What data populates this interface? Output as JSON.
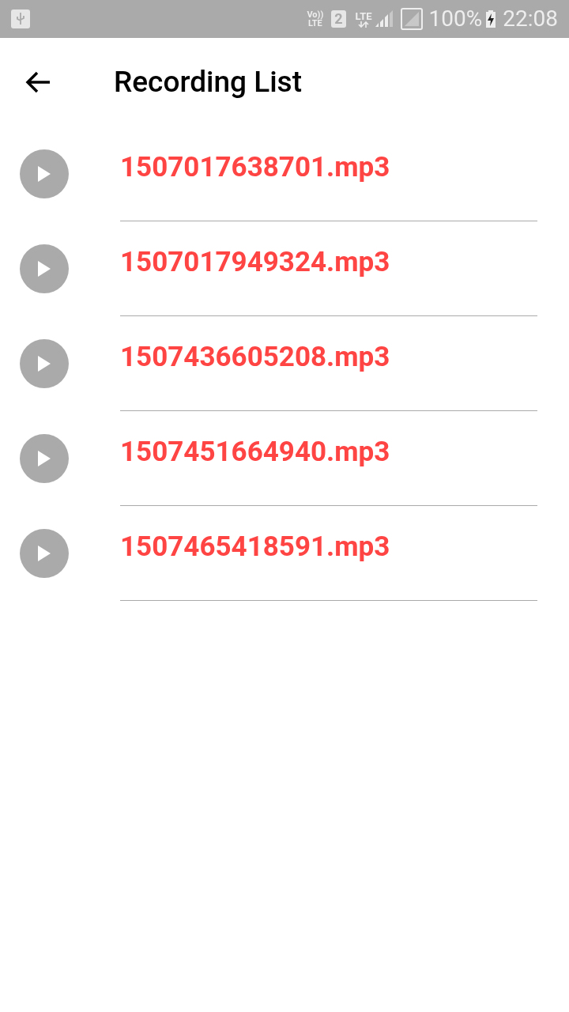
{
  "status_bar": {
    "volte_top": "Vo))",
    "volte_bottom": "LTE",
    "sim": "2",
    "network": "LTE",
    "battery": "100%",
    "time": "22:08"
  },
  "toolbar": {
    "title": "Recording List"
  },
  "recordings": [
    {
      "name": "1507017638701.mp3"
    },
    {
      "name": "1507017949324.mp3"
    },
    {
      "name": "1507436605208.mp3"
    },
    {
      "name": "1507451664940.mp3"
    },
    {
      "name": "1507465418591.mp3"
    }
  ]
}
